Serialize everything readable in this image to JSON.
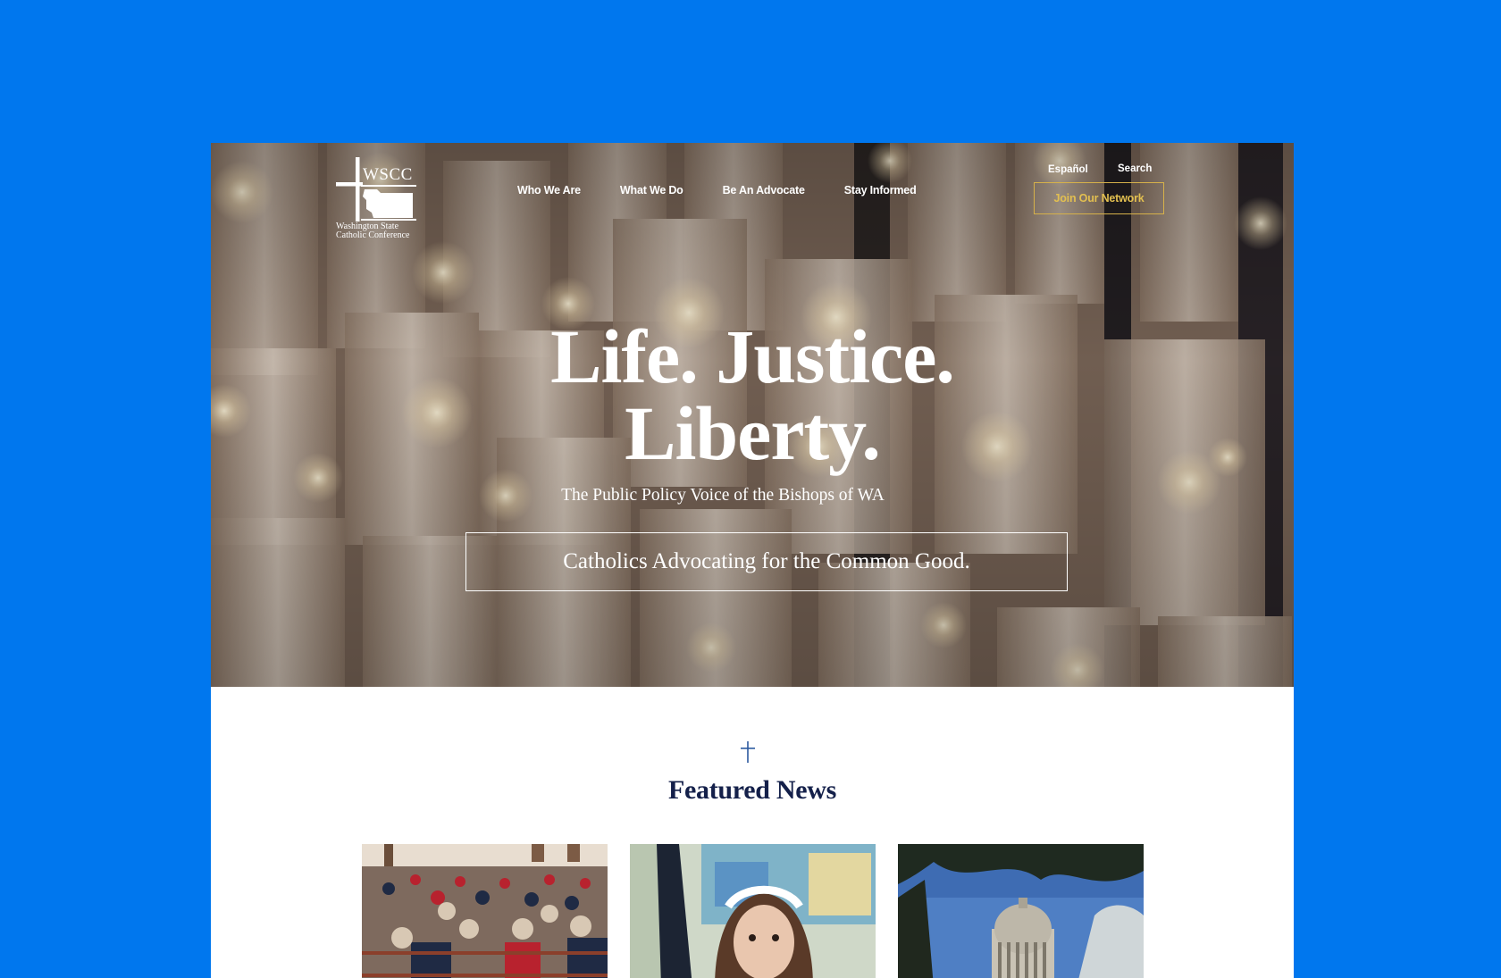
{
  "colors": {
    "background": "#0077ee",
    "accent_gold": "#d6b14a",
    "navy": "#14204a",
    "cross_blue": "#2c5aa0"
  },
  "logo": {
    "acronym": "WSCC",
    "line1": "Washington State",
    "line2": "Catholic Conference"
  },
  "nav": {
    "items": [
      {
        "label": "Who We Are"
      },
      {
        "label": "What We Do"
      },
      {
        "label": "Be An Advocate"
      },
      {
        "label": "Stay Informed"
      }
    ],
    "language": "Español",
    "search": "Search",
    "join": "Join Our Network"
  },
  "hero": {
    "title_line1": "Life. Justice.",
    "title_line2": "Liberty.",
    "subtitle": "The Public Policy Voice of the Bishops of WA",
    "cta": "Catholics Advocating for the Common Good."
  },
  "featured": {
    "icon": "cross-icon",
    "title": "Featured News",
    "cards": [
      {
        "image": "church-congregation-photo"
      },
      {
        "image": "student-raising-hand-photo"
      },
      {
        "image": "state-capitol-dome-photo"
      }
    ]
  }
}
